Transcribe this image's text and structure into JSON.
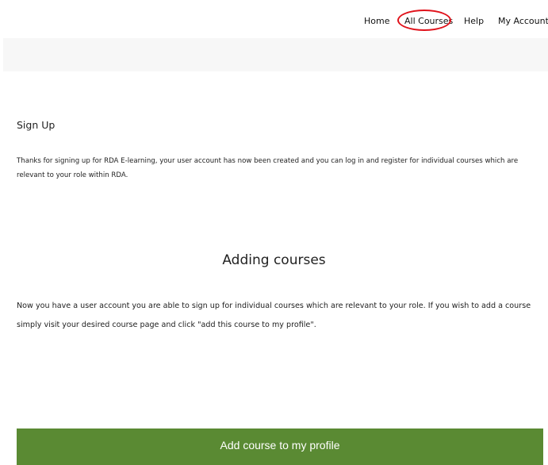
{
  "nav": {
    "home": "Home",
    "all_courses": "All Courses",
    "help": "Help",
    "my_account": "My Account"
  },
  "highlight_color": "#e0121b",
  "signup": {
    "title": "Sign Up",
    "text": "Thanks for signing up for RDA E-learning, your user account has now been created and you can log in and register for individual courses which are relevant to your role within RDA."
  },
  "adding": {
    "title": "Adding courses",
    "text": "Now you have a user account you are able to sign up for individual courses which are relevant to your role. If you wish to add a course simply visit your desired course page and click \"add this course to my profile\"."
  },
  "cta": {
    "label": "Add course to my profile",
    "color": "#5a8a33"
  }
}
